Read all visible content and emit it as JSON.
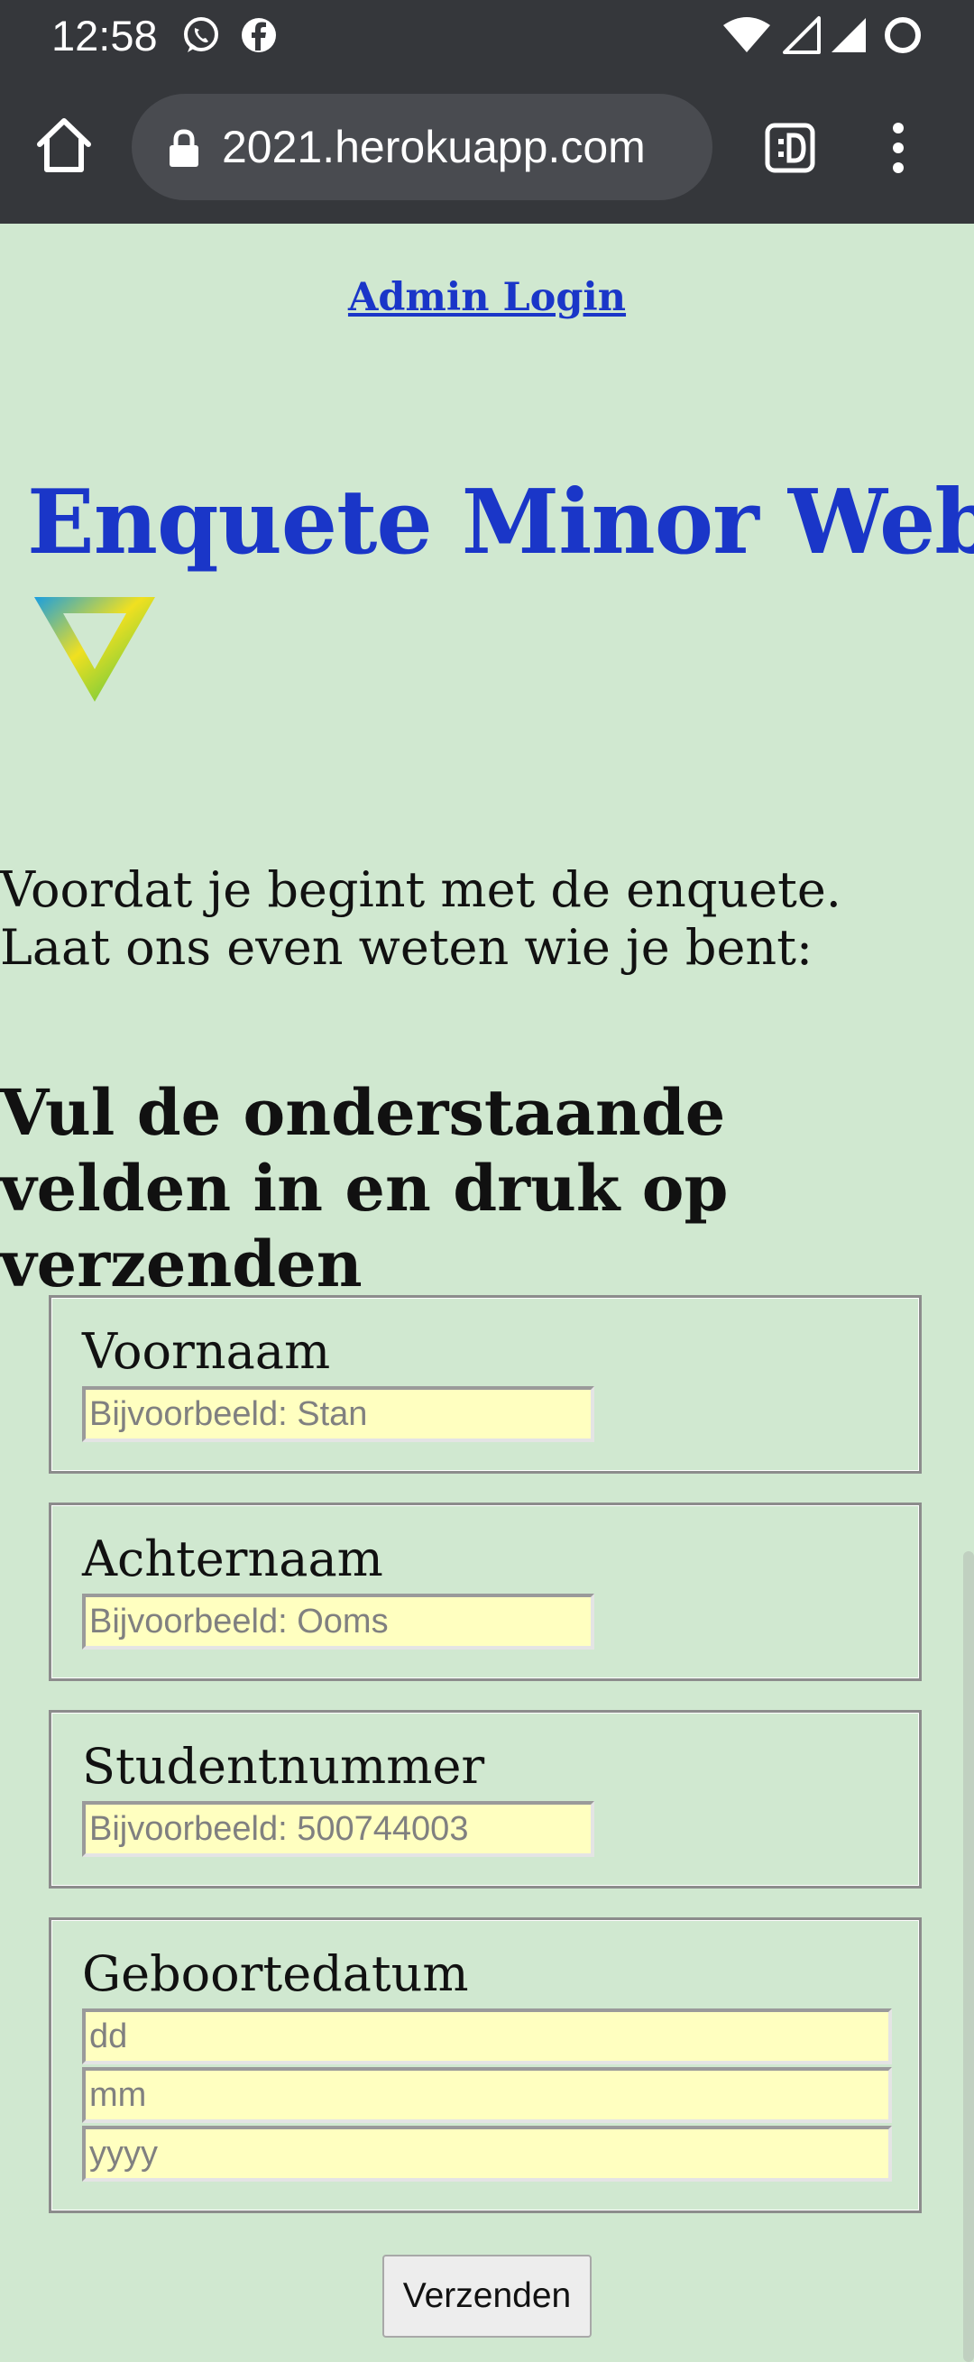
{
  "status_bar": {
    "time": "12:58",
    "icons": [
      "whatsapp-icon",
      "facebook-icon",
      "wifi-icon",
      "signal-empty-icon",
      "signal-full-icon",
      "battery-ring-icon"
    ]
  },
  "browser": {
    "url": "2021.herokuapp.com",
    "buttons": [
      "home-icon",
      "lock-icon",
      "desktop-site-icon",
      "more-vert-icon"
    ]
  },
  "page": {
    "admin_link": "Admin Login",
    "title": "Enquete Minor Web",
    "intro": "Voordat je begint met de enquete. Laat ons even weten wie je bent:",
    "instruction": "Vul de onderstaande velden in en druk op verzenden",
    "colors": {
      "background": "#d0e8d0",
      "link_blue": "#1a36c8",
      "input_yellow": "#ffffc0",
      "chrome_dark": "#35373b"
    }
  },
  "form": {
    "firstname": {
      "label": "Voornaam",
      "placeholder": "Bijvoorbeeld: Stan"
    },
    "lastname": {
      "label": "Achternaam",
      "placeholder": "Bijvoorbeeld: Ooms"
    },
    "studentnumber": {
      "label": "Studentnummer",
      "placeholder": "Bijvoorbeeld: 500744003"
    },
    "birthdate": {
      "label": "Geboortedatum",
      "day_placeholder": "dd",
      "month_placeholder": "mm",
      "year_placeholder": "yyyy"
    },
    "submit_label": "Verzenden"
  }
}
